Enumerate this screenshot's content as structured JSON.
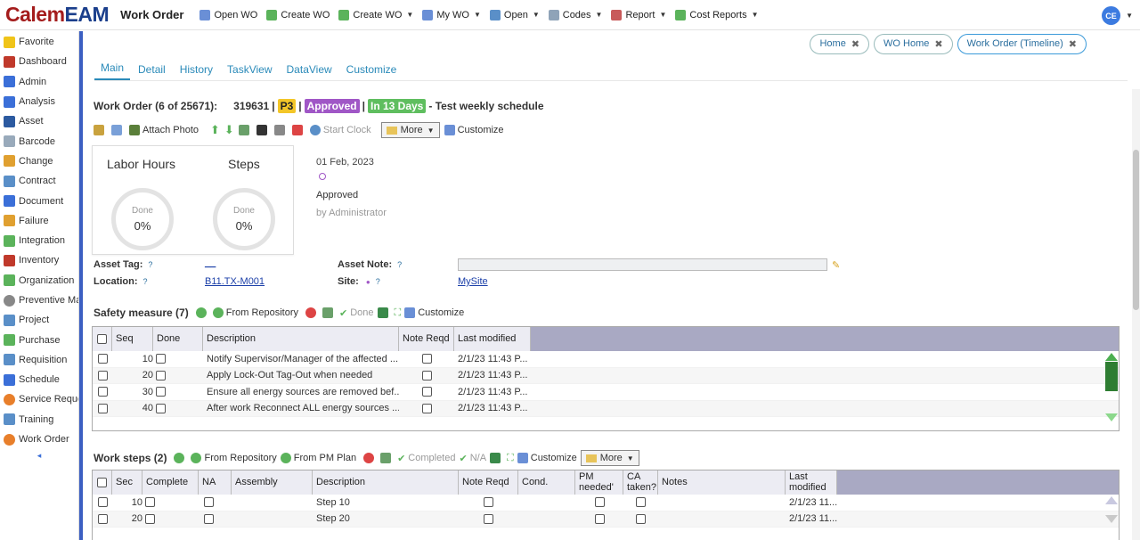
{
  "brand": {
    "name_a": "Calem",
    "name_b": "EAM",
    "module": "Work Order"
  },
  "topmenu": [
    {
      "label": "Open WO",
      "icon": "open-wo-icon",
      "color": "#6a8fd6",
      "caret": false
    },
    {
      "label": "Create WO",
      "icon": "create-wo-icon",
      "color": "#5bb35b",
      "caret": false
    },
    {
      "label": "Create WO",
      "icon": "create-wo-icon",
      "color": "#5bb35b",
      "caret": true
    },
    {
      "label": "My WO",
      "icon": "my-wo-icon",
      "color": "#6a8fd6",
      "caret": true
    },
    {
      "label": "Open",
      "icon": "open-icon",
      "color": "#5a8fc8",
      "caret": true
    },
    {
      "label": "Codes",
      "icon": "codes-icon",
      "color": "#8fa3b8",
      "caret": true
    },
    {
      "label": "Report",
      "icon": "report-icon",
      "color": "#c85a5a",
      "caret": true
    },
    {
      "label": "Cost Reports",
      "icon": "cost-reports-icon",
      "color": "#5bb35b",
      "caret": true
    }
  ],
  "user": {
    "initials": "CE"
  },
  "sidebar": {
    "items": [
      {
        "label": "Favorite",
        "icon": "star-icon",
        "color": "#f0c419"
      },
      {
        "label": "Dashboard",
        "icon": "dashboard-icon",
        "color": "#c0392b"
      },
      {
        "label": "Admin",
        "icon": "admin-icon",
        "color": "#3b6fd8"
      },
      {
        "label": "Analysis",
        "icon": "analysis-icon",
        "color": "#3b6fd8"
      },
      {
        "label": "Asset",
        "icon": "asset-icon",
        "color": "#2c5aa0"
      },
      {
        "label": "Barcode",
        "icon": "barcode-icon",
        "color": "#9ab"
      },
      {
        "label": "Change",
        "icon": "change-icon",
        "color": "#e0a030"
      },
      {
        "label": "Contract",
        "icon": "contract-icon",
        "color": "#5a8fc8"
      },
      {
        "label": "Document",
        "icon": "document-icon",
        "color": "#3b6fd8"
      },
      {
        "label": "Failure",
        "icon": "failure-icon",
        "color": "#e0a030"
      },
      {
        "label": "Integration",
        "icon": "integration-icon",
        "color": "#5bb35b"
      },
      {
        "label": "Inventory",
        "icon": "inventory-icon",
        "color": "#c0392b"
      },
      {
        "label": "Organization",
        "icon": "organization-icon",
        "color": "#5bb35b"
      },
      {
        "label": "Preventive Ma",
        "icon": "preventive-icon",
        "color": "#888"
      },
      {
        "label": "Project",
        "icon": "project-icon",
        "color": "#5a8fc8"
      },
      {
        "label": "Purchase",
        "icon": "purchase-icon",
        "color": "#5bb35b"
      },
      {
        "label": "Requisition",
        "icon": "requisition-icon",
        "color": "#5a8fc8"
      },
      {
        "label": "Schedule",
        "icon": "schedule-icon",
        "color": "#3b6fd8"
      },
      {
        "label": "Service Reque",
        "icon": "service-request-icon",
        "color": "#e87f2b"
      },
      {
        "label": "Training",
        "icon": "training-icon",
        "color": "#5a8fc8"
      },
      {
        "label": "Work Order",
        "icon": "work-order-icon",
        "color": "#e87f2b"
      }
    ],
    "collapse": "◂"
  },
  "opentabs": [
    {
      "label": "Home",
      "active": false
    },
    {
      "label": "WO Home",
      "active": false
    },
    {
      "label": "Work Order (Timeline)",
      "active": true
    }
  ],
  "subtabs": [
    "Main",
    "Detail",
    "History",
    "TaskView",
    "DataView",
    "Customize"
  ],
  "wo": {
    "prefix": "Work Order (6 of 25671):",
    "number": "319631",
    "sep": "|",
    "priority": "P3",
    "status": "Approved",
    "due": "In 13 Days",
    "desc": "- Test weekly schedule"
  },
  "toolbar": {
    "attach": "Attach Photo",
    "start_clock": "Start Clock",
    "more": "More",
    "customize": "Customize"
  },
  "progress": {
    "labor": {
      "title": "Labor Hours",
      "label": "Done",
      "value": "0%"
    },
    "steps": {
      "title": "Steps",
      "label": "Done",
      "value": "0%"
    }
  },
  "timeline": {
    "date": "01 Feb, 2023",
    "status": "Approved",
    "by": "by Administrator"
  },
  "fields": {
    "asset_tag": {
      "label": "Asset Tag:",
      "value": "__"
    },
    "location": {
      "label": "Location:",
      "value": "B11.TX-M001"
    },
    "asset_note": {
      "label": "Asset Note:"
    },
    "site": {
      "label": "Site:",
      "value": "MySite"
    },
    "help": "?"
  },
  "safety": {
    "title": "Safety measure (7)",
    "tools": {
      "from_repo": "From Repository",
      "done": "Done",
      "customize": "Customize"
    },
    "columns": {
      "seq": "Seq",
      "done": "Done",
      "desc": "Description",
      "note": "Note Reqd",
      "last": "Last modified"
    },
    "rows": [
      {
        "seq": "10",
        "desc": "Notify Supervisor/Manager of the affected ...",
        "last": "2/1/23 11:43 P..."
      },
      {
        "seq": "20",
        "desc": "Apply Lock-Out Tag-Out when needed",
        "last": "2/1/23 11:43 P..."
      },
      {
        "seq": "30",
        "desc": "Ensure all energy sources are removed bef...",
        "last": "2/1/23 11:43 P..."
      },
      {
        "seq": "40",
        "desc": "After work Reconnect ALL energy sources ...",
        "last": "2/1/23 11:43 P..."
      }
    ]
  },
  "worksteps": {
    "title": "Work steps (2)",
    "tools": {
      "from_repo": "From Repository",
      "from_pm": "From PM Plan",
      "completed": "Completed",
      "na": "N/A",
      "customize": "Customize",
      "more": "More"
    },
    "columns": {
      "seq": "Sec",
      "complete": "Complete",
      "na": "NA",
      "assembly": "Assembly",
      "desc": "Description",
      "note": "Note Reqd",
      "cond": "Cond.",
      "pm": "PM needed'",
      "ca": "CA taken?",
      "notes": "Notes",
      "last": "Last modified"
    },
    "rows": [
      {
        "seq": "10",
        "desc": "Step 10",
        "last": "2/1/23 11..."
      },
      {
        "seq": "20",
        "desc": "Step 20",
        "last": "2/1/23 11..."
      }
    ]
  }
}
